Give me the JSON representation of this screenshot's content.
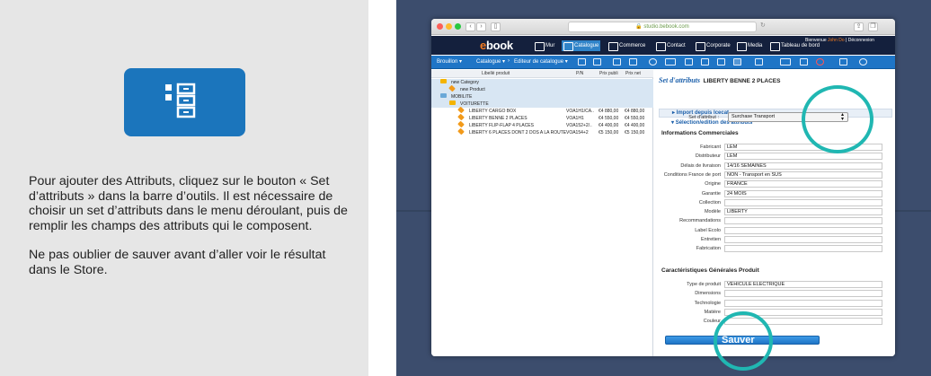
{
  "intro": {
    "paragraph1": "Pour ajouter des Attributs, cliquez sur le bouton « Set d’attributs » dans la barre d’outils. Il est nécessaire de choisir un set d’attributs dans le menu déroulant, puis de remplir les champs des attributs qui le composent.",
    "paragraph2": "Ne pas oublier de sauver avant d’aller voir le résultat dans le Store."
  },
  "colors": {
    "accent": "#1b75bc",
    "highlight_ring": "#20b7b2",
    "brand_orange": "#f47b20",
    "background_dark": "#3c4d6d"
  },
  "browser": {
    "url": "studio.bebook.com"
  },
  "brand": {
    "logo_prefix": "e",
    "logo_rest": "book"
  },
  "nav": {
    "items": [
      "Mur",
      "Catalogue",
      "Commerce",
      "Contact",
      "Corporate",
      "Media",
      "Tableau de bord"
    ],
    "active": "Catalogue",
    "welcome": "Bienvenue",
    "user": "John Do",
    "separator": "|",
    "logout": "Déconnexion"
  },
  "toolbar": {
    "mode": "Brouillon",
    "catalog": "Catalogue",
    "editor": "Editeur de catalogue",
    "icons": [
      "category-icon",
      "calendar-icon",
      "barcode-icon",
      "globe-icon",
      "tax-icon",
      "list-icon",
      "import-icon",
      "columns-icon",
      "attributes-set-icon",
      "tag-icon",
      "tags-icon",
      "delete-icon",
      "export-icon",
      "search-icon"
    ]
  },
  "grid": {
    "headers": [
      "Libellé produit",
      "P/N",
      "Prix publi",
      "Prix net"
    ],
    "rows": [
      {
        "label": "new Category",
        "pn": "",
        "price_public": "",
        "price_net": "",
        "kind": "folder",
        "level": 0,
        "highlight": true
      },
      {
        "label": "new Product",
        "pn": "",
        "price_public": "",
        "price_net": "",
        "kind": "product",
        "level": 1,
        "highlight": true
      },
      {
        "label": "MOBILITE",
        "pn": "",
        "price_public": "",
        "price_net": "",
        "kind": "folder",
        "level": 0,
        "highlight": true
      },
      {
        "label": "VOITURETTE",
        "pn": "",
        "price_public": "",
        "price_net": "",
        "kind": "folder",
        "level": 1,
        "highlight": true
      },
      {
        "label": "LIBERTY CARGO BOX",
        "pn": "VOA1H1/CA..",
        "price_public": "€4 880,00",
        "price_net": "€4 880,00",
        "kind": "product",
        "level": 2,
        "highlight": false
      },
      {
        "label": "LIBERTY BENNE 2 PLACES",
        "pn": "VOA1H1",
        "price_public": "€4 550,00",
        "price_net": "€4 550,00",
        "kind": "product",
        "level": 2,
        "highlight": false
      },
      {
        "label": "LIBERTY FLIP-FLAP 4 PLACES",
        "pn": "VOA152+2/..",
        "price_public": "€4 400,00",
        "price_net": "€4 400,00",
        "kind": "product",
        "level": 2,
        "highlight": false
      },
      {
        "label": "LIBERTY 6 PLACES DONT 2 DOS A LA ROUTE",
        "pn": "VOA154+2",
        "price_public": "€5 150,00",
        "price_net": "€5 150,00",
        "kind": "product",
        "level": 2,
        "highlight": false
      }
    ]
  },
  "attributes": {
    "title_prefix": "Set d'attributs",
    "product_name": "LIBERTY BENNE 2 PLACES",
    "import_section": "Import depuis Icecat",
    "selection_section": "Sélection/edition des attributs",
    "set_label": "Set d'attribut :",
    "set_value": "Surchase Transport",
    "group1_title": "Informations Commerciales",
    "group1_fields": [
      {
        "label": "Fabricant",
        "value": "LEM"
      },
      {
        "label": "Distributeur",
        "value": "LEM"
      },
      {
        "label": "Délais de livraison",
        "value": "14/16 SEMAINES"
      },
      {
        "label": "Conditions France de port",
        "value": "NON - Transport en SUS"
      },
      {
        "label": "Origine",
        "value": "FRANCE"
      },
      {
        "label": "Garantie",
        "value": "24 MOIS"
      },
      {
        "label": "Collection",
        "value": ""
      },
      {
        "label": "Modèle",
        "value": "LIBERTY"
      },
      {
        "label": "Recommandations",
        "value": ""
      },
      {
        "label": "Label Ecolo",
        "value": ""
      },
      {
        "label": "Entretien",
        "value": ""
      },
      {
        "label": "Fabrication",
        "value": ""
      }
    ],
    "group2_title": "Caractéristiques Générales Produit",
    "group2_fields": [
      {
        "label": "Type de produit",
        "value": "VEHICULE ELECTRIQUE"
      },
      {
        "label": "Dimensions",
        "value": ""
      },
      {
        "label": "Technologie",
        "value": ""
      },
      {
        "label": "Matière",
        "value": ""
      },
      {
        "label": "Couleur",
        "value": ""
      }
    ],
    "save_label": "Sauver"
  }
}
